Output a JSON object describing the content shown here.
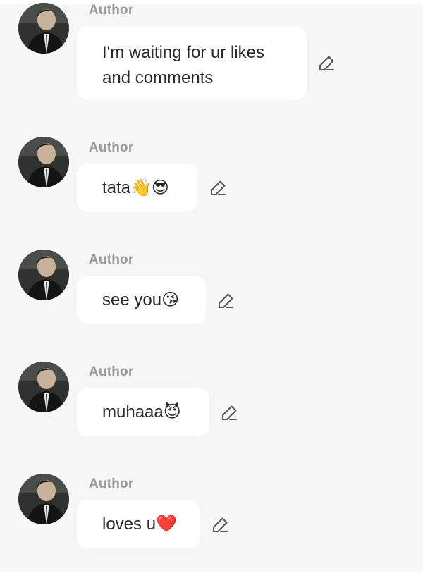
{
  "messages": [
    {
      "author": "Author",
      "text": "I'm waiting for ur likes and comments",
      "line1": "I'm waiting for ur likes",
      "line2": "and comments",
      "emoji": ""
    },
    {
      "author": "Author",
      "text": "tata",
      "emoji": "👋😎"
    },
    {
      "author": "Author",
      "text": "see you",
      "emoji": "😘"
    },
    {
      "author": "Author",
      "text": "muhaaa",
      "emoji": "😈"
    },
    {
      "author": "Author",
      "text": "loves u",
      "emoji": "❤️"
    }
  ],
  "icons": {
    "edit": "pencil-icon",
    "avatar": "profile-photo"
  },
  "colors": {
    "background": "#f6f6f6",
    "bubble": "#ffffff",
    "author": "#9a9a9a",
    "text": "#2a2a2a"
  }
}
